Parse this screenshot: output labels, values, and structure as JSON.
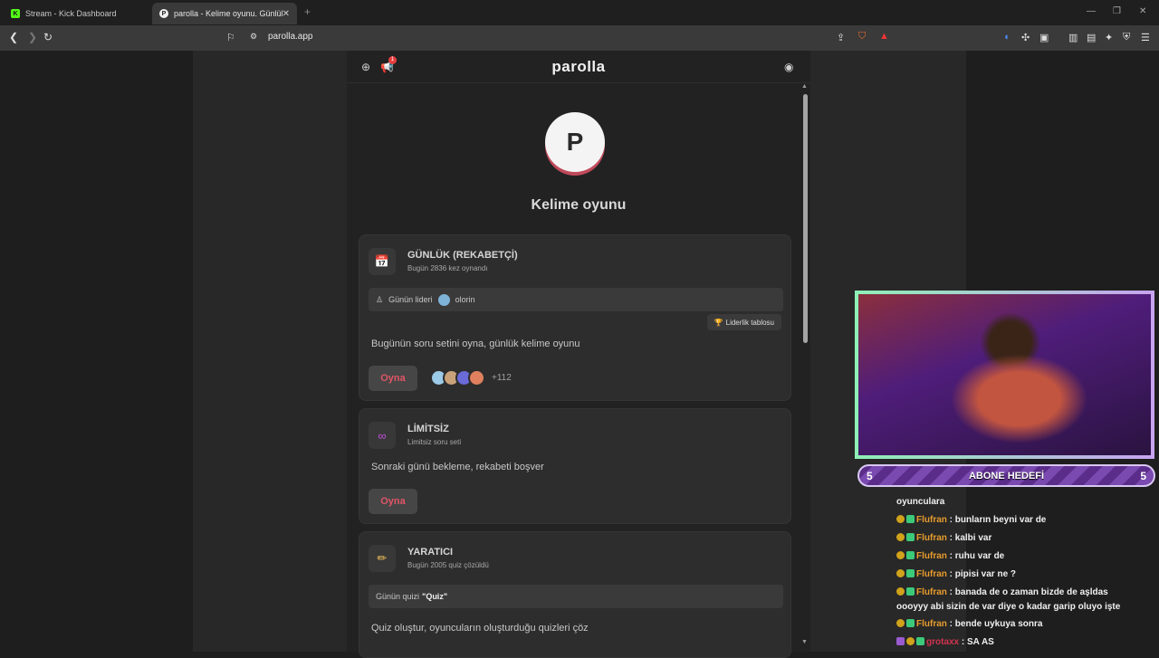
{
  "browser": {
    "tabs": [
      {
        "label": "Stream - Kick Dashboard",
        "favicon": "K",
        "active": false
      },
      {
        "label": "parolla - Kelime oyunu. Günlük k",
        "favicon": "P",
        "active": true
      }
    ],
    "url": "parolla.app",
    "shield_count": "4"
  },
  "app": {
    "brand": "parolla",
    "notification_count": "1",
    "logo_letter": "P",
    "title": "Kelime oyunu",
    "cards": [
      {
        "icon": "calendar-icon",
        "title": "GÜNLÜK (REKABETÇİ)",
        "subtitle": "Bugün 2836 kez oynandı",
        "leader_label": "Günün lideri",
        "leader_name": "olorin",
        "leaderboard_label": "Liderlik tablosu",
        "description": "Bugünün soru setini oyna, günlük kelime oyunu",
        "play_label": "Oyna",
        "player_extra": "+112"
      },
      {
        "icon": "infinity-icon",
        "title": "LİMİTSİZ",
        "subtitle": "Limitsiz soru seti",
        "description": "Sonraki günü bekleme, rekabeti boşver",
        "play_label": "Oyna"
      },
      {
        "icon": "pencil-icon",
        "title": "YARATICI",
        "subtitle": "Bugün 2005 quiz çözüldü",
        "quiz_label": "Günün quizi",
        "quiz_name": "\"Quiz\"",
        "description": "Quiz oluştur, oyuncuların oluşturduğu quizleri çöz"
      }
    ]
  },
  "stream": {
    "goal_label": "ABONE HEDEFİ",
    "goal_left": "5",
    "goal_right": "5",
    "chat": [
      {
        "user": "",
        "text": "oyunculara"
      },
      {
        "user": "Flufran",
        "text": " : bunların beyni var de"
      },
      {
        "user": "Flufran",
        "text": " : kalbi var"
      },
      {
        "user": "Flufran",
        "text": " : ruhu var de"
      },
      {
        "user": "Flufran",
        "text": " : pipisi var ne ?"
      },
      {
        "user": "Flufran",
        "text": " : banada de o zaman bizde de aşldas"
      },
      {
        "user": "",
        "text": "oooyyy abi sizin de var diye o kadar garip oluyo işte"
      },
      {
        "user": "Flufran",
        "text": " : bende uykuya sonra"
      },
      {
        "user": "grotaxx",
        "text": " : SA AS"
      }
    ]
  },
  "colors": {
    "accent": "#e05567",
    "logo_shadow": "#c04a5a",
    "chat_user": "#e89c2d",
    "chat_user2": "#d2344f"
  }
}
